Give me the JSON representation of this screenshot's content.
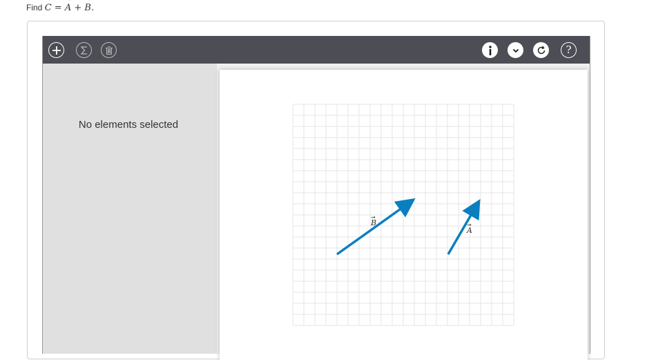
{
  "prompt": {
    "find_label": "Find",
    "vec_c": "C",
    "equals": "=",
    "vec_a": "A",
    "plus": "+",
    "vec_b": "B",
    "period": "."
  },
  "toolbar": {
    "add_icon": "plus-icon",
    "sum_icon": "sigma-icon",
    "delete_icon": "trash-icon",
    "info_icon": "info-icon",
    "dropdown_icon": "chevron-down-icon",
    "reset_icon": "refresh-icon",
    "help_icon": "question-icon",
    "help_glyph": "?"
  },
  "left_panel": {
    "status_text": "No elements selected"
  },
  "canvas": {
    "vectors": [
      {
        "name": "A",
        "label": "A",
        "color": "#0a7fc0"
      },
      {
        "name": "B",
        "label": "B",
        "color": "#0a7fc0"
      }
    ]
  },
  "colors": {
    "toolbar_bg": "#4c4d55",
    "panel_bg": "#e0e0e0",
    "vector_blue": "#0a7fc0",
    "grid_line": "#e6e6e6"
  }
}
